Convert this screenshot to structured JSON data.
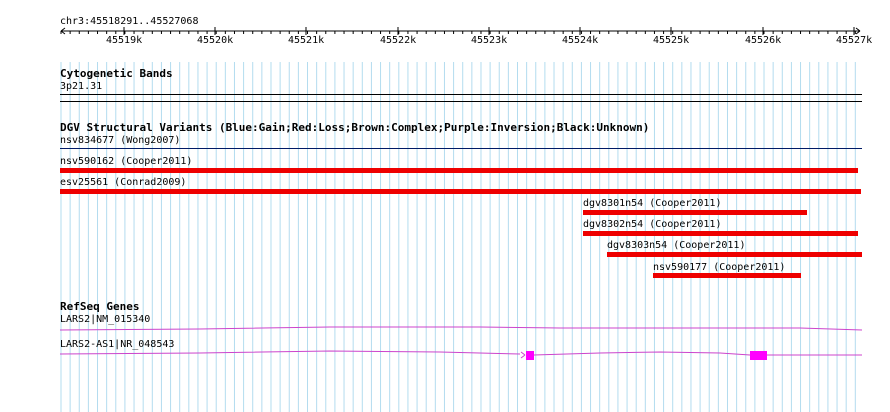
{
  "ruler": {
    "position": "chr3:45518291..45527068",
    "ticks": [
      "45519k",
      "45520k",
      "45521k",
      "45522k",
      "45523k",
      "45524k",
      "45525k",
      "45526k",
      "45527k"
    ]
  },
  "cytoband": {
    "title": "Cytogenetic Bands",
    "band": "3p21.31"
  },
  "dgv": {
    "title": "DGV Structural Variants (Blue:Gain;Red:Loss;Brown:Complex;Purple:Inversion;Black:Unknown)",
    "features": [
      {
        "label": "nsv834677 (Wong2007)",
        "color": "#001a66"
      },
      {
        "label": "nsv590162 (Cooper2011)",
        "color": "#ee0000"
      },
      {
        "label": "esv25561 (Conrad2009)",
        "color": "#ee0000"
      },
      {
        "label": "dgv8301n54 (Cooper2011)",
        "color": "#ee0000"
      },
      {
        "label": "dgv8302n54 (Cooper2011)",
        "color": "#ee0000"
      },
      {
        "label": "dgv8303n54 (Cooper2011)",
        "color": "#ee0000"
      },
      {
        "label": "nsv590177 (Cooper2011)",
        "color": "#ee0000"
      }
    ]
  },
  "refseq": {
    "title": "RefSeq Genes",
    "genes": [
      {
        "label": "LARS2|NM_015340",
        "color": "#cc44cc"
      },
      {
        "label": "LARS2-AS1|NR_048543",
        "color": "#cc44cc",
        "exon_color": "#ff00ff"
      }
    ]
  },
  "colors": {
    "gridline": "#b3dcef",
    "loss": "#ee0000",
    "gene": "#cc44cc"
  }
}
